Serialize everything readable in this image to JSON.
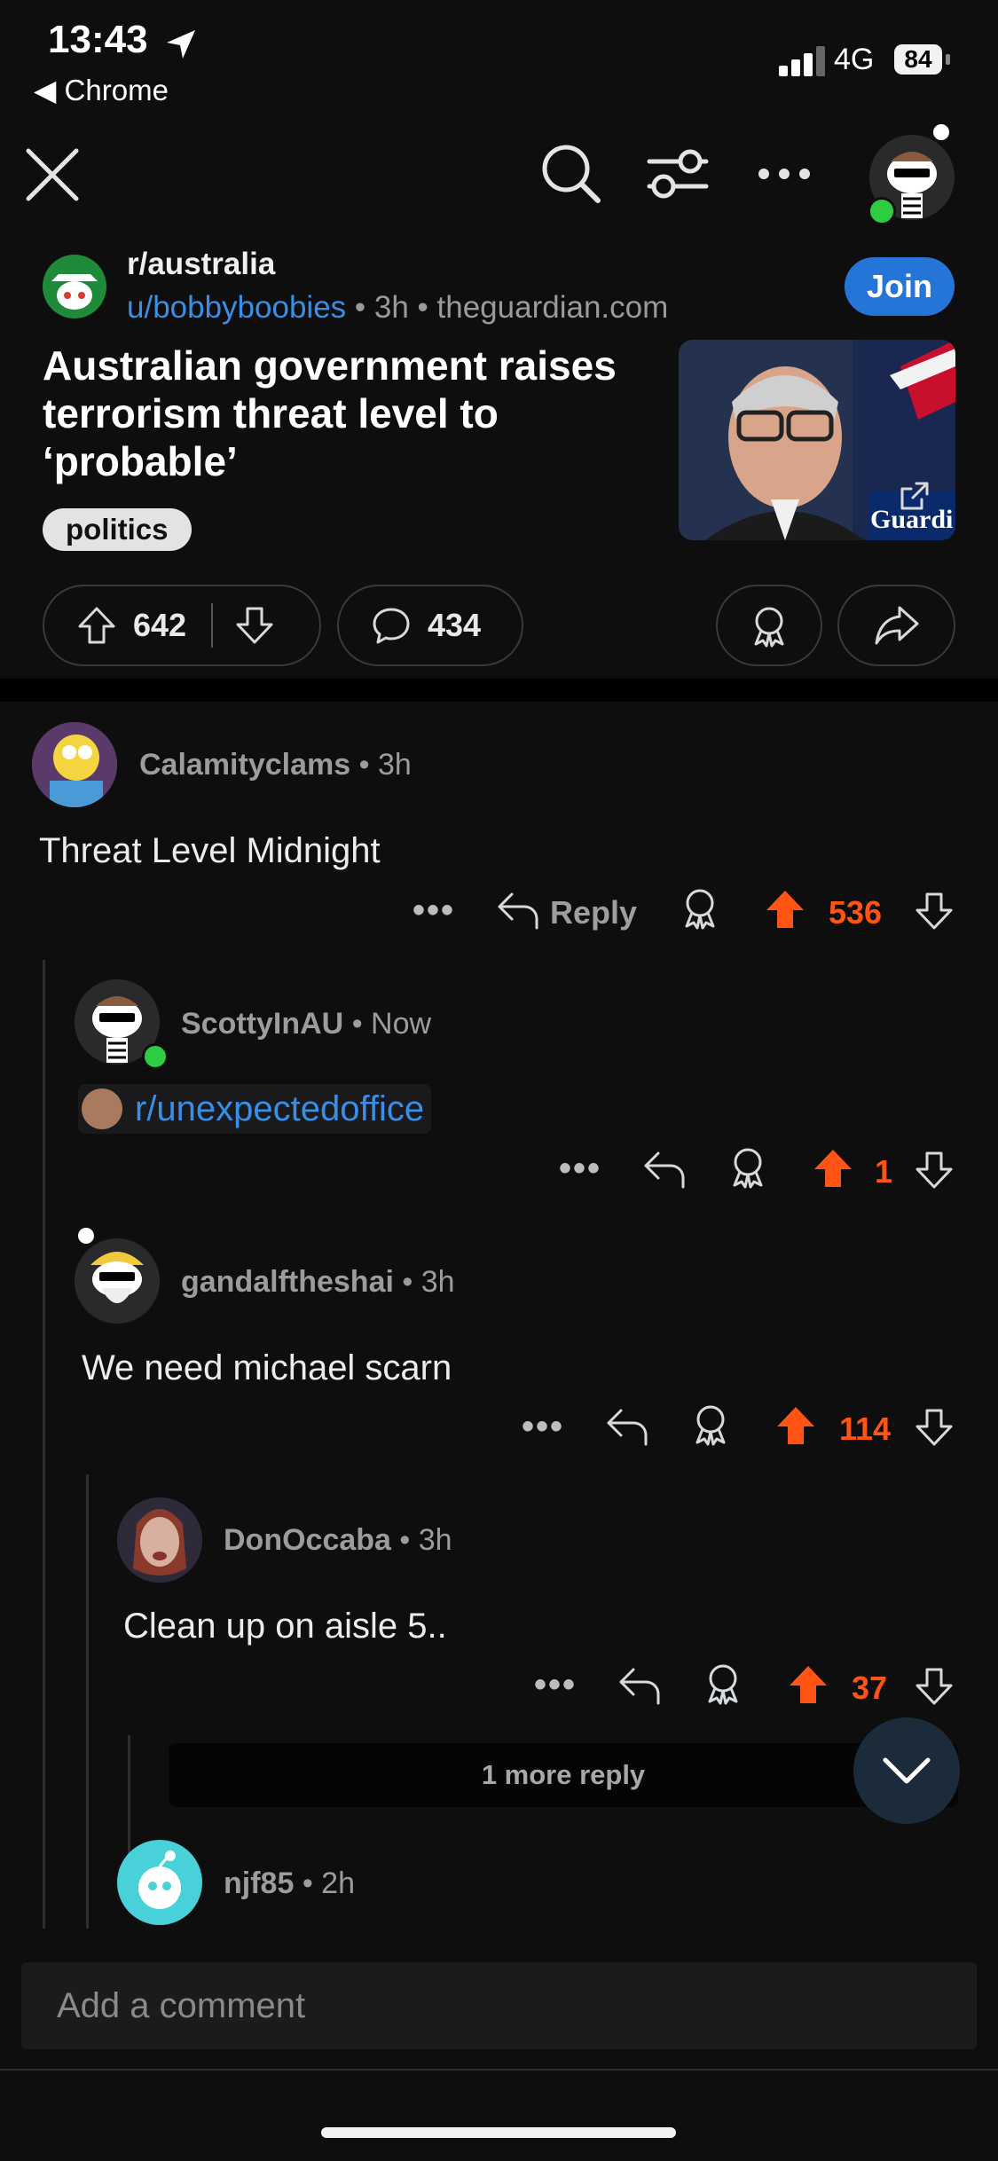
{
  "status_bar": {
    "time": "13:43",
    "back_app": "◀ Chrome",
    "network": "4G",
    "battery": "84"
  },
  "header": {
    "icons": [
      "close-icon",
      "search-icon",
      "filter-icon",
      "more-icon",
      "profile-avatar"
    ]
  },
  "post": {
    "subreddit": "r/australia",
    "author": "u/bobbyboobies",
    "time": "3h",
    "domain": "theguardian.com",
    "join_label": "Join",
    "title": "Australian government raises terrorism threat level to ‘probable’",
    "flair": "politics",
    "thumbnail_watermark": "Guardi",
    "upvotes": "642",
    "comments": "434"
  },
  "comments": [
    {
      "user": "Calamityclams",
      "time": "3h",
      "body": "Threat Level Midnight",
      "reply_label": "Reply",
      "score": "536"
    },
    {
      "user": "ScottyInAU",
      "time": "Now",
      "link": "r/unexpectedoffice",
      "score": "1"
    },
    {
      "user": "gandalftheshai",
      "time": "3h",
      "body": "We need michael scarn",
      "score": "114"
    },
    {
      "user": "DonOccaba",
      "time": "3h",
      "body": "Clean up on aisle 5..",
      "score": "37"
    },
    {
      "user": "njf85",
      "time": "2h"
    }
  ],
  "more_reply": "1 more reply",
  "add_comment_placeholder": "Add a comment",
  "colors": {
    "upvote": "#ff5414",
    "join": "#2575d8",
    "link": "#3a8ee6",
    "background": "#0e0e0f"
  }
}
